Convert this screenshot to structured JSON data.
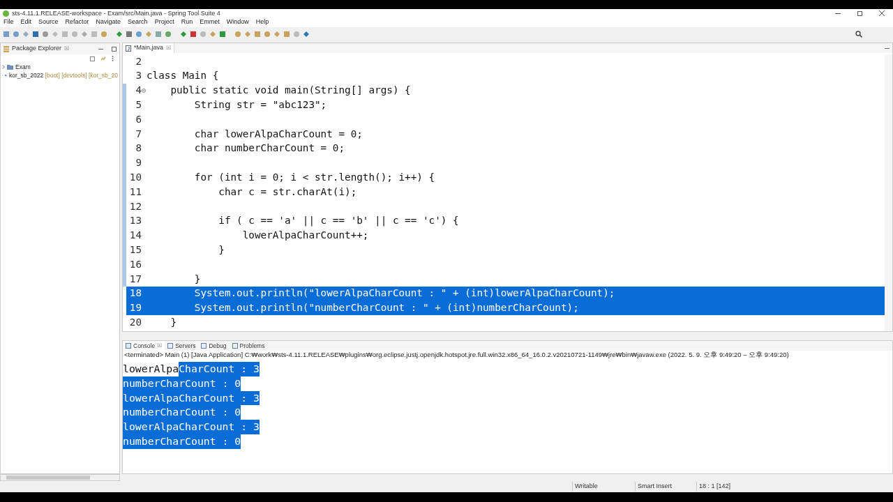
{
  "window": {
    "title": "sts-4.11.1.RELEASE-workspace - Exam/src/Main.java - Spring Tool Suite 4"
  },
  "menu": [
    "File",
    "Edit",
    "Source",
    "Refactor",
    "Navigate",
    "Search",
    "Project",
    "Run",
    "Emmet",
    "Window",
    "Help"
  ],
  "package_explorer": {
    "title": "Package Explorer",
    "close": "☒",
    "items": [
      {
        "label": "Exam"
      },
      {
        "label": "kor_sb_2022",
        "decoration": "[boot] [devtools] [kor_sb_20"
      }
    ]
  },
  "editor": {
    "tab": {
      "label": "*Main.java",
      "close": "☒"
    },
    "lines": [
      {
        "number": "2",
        "selected": false,
        "fold": false
      },
      {
        "number": "3",
        "text": "class Main {",
        "selected": false,
        "fold": false
      },
      {
        "number": "4",
        "text": "    public static void main(String[] args) {",
        "selected": false,
        "fold": true
      },
      {
        "number": "5",
        "text": "        String str = \"abc123\";",
        "selected": false,
        "fold": false
      },
      {
        "number": "6",
        "selected": false,
        "fold": false
      },
      {
        "number": "7",
        "text": "        char lowerAlpaCharCount = 0;",
        "selected": false,
        "fold": false
      },
      {
        "number": "8",
        "text": "        char numberCharCount = 0;",
        "selected": false,
        "fold": false
      },
      {
        "number": "9",
        "selected": false,
        "fold": false
      },
      {
        "number": "10",
        "text": "        for (int i = 0; i < str.length(); i++) {",
        "selected": false,
        "fold": false
      },
      {
        "number": "11",
        "text": "            char c = str.charAt(i);",
        "selected": false,
        "fold": false
      },
      {
        "number": "12",
        "selected": false,
        "fold": false
      },
      {
        "number": "13",
        "text": "            if ( c == 'a' || c == 'b' || c == 'c') {",
        "selected": false,
        "fold": false
      },
      {
        "number": "14",
        "text": "                lowerAlpaCharCount++;",
        "selected": false,
        "fold": false
      },
      {
        "number": "15",
        "text": "            }",
        "selected": false,
        "fold": false
      },
      {
        "number": "16",
        "selected": false,
        "fold": false
      },
      {
        "number": "17",
        "text": "        }",
        "selected": false,
        "fold": false
      },
      {
        "number": "18",
        "text": "        System.out.println(\"lowerAlpaCharCount : \" + (int)lowerAlpaCharCount);",
        "selected": true,
        "fold": false
      },
      {
        "number": "19",
        "text": "        System.out.println(\"numberCharCount : \" + (int)numberCharCount);",
        "selected": true,
        "fold": false
      },
      {
        "number": "20",
        "text": "    }",
        "selected": false,
        "fold": false
      }
    ]
  },
  "console": {
    "tabs": [
      {
        "label": "Console",
        "selected": true,
        "close": "☒"
      },
      {
        "label": "Servers",
        "selected": false
      },
      {
        "label": "Debug",
        "selected": false
      },
      {
        "label": "Problems",
        "selected": false
      }
    ],
    "status": "<terminated> Main (1) [Java Application] C:₩work₩sts-4.11.1.RELEASE₩plugins₩org.eclipse.justj.openjdk.hotspot.jre.full.win32.x86_64_16.0.2.v20210721-1149₩jre₩bin₩javaw.exe  (2022. 5. 9. 오후 9:49:20 – 오후 9:49:20)",
    "lines": [
      [
        {
          "text": "lowerAlpa",
          "selected": false
        },
        {
          "text": "CharCount : 3",
          "selected": true
        }
      ],
      [
        {
          "text": "numberCharCount : 0",
          "selected": true
        }
      ],
      [
        {
          "text": "lowerAlpaCharCount : 3",
          "selected": true
        }
      ],
      [
        {
          "text": "numberCharCount : 0",
          "selected": true
        }
      ],
      [
        {
          "text": "lowerAlpaCharCount : 3",
          "selected": true
        }
      ],
      [
        {
          "text": "numberCharCount : 0",
          "selected": true
        }
      ]
    ]
  },
  "status_bar": [
    "Writable",
    "Smart Insert",
    "18 : 1 [142]"
  ]
}
